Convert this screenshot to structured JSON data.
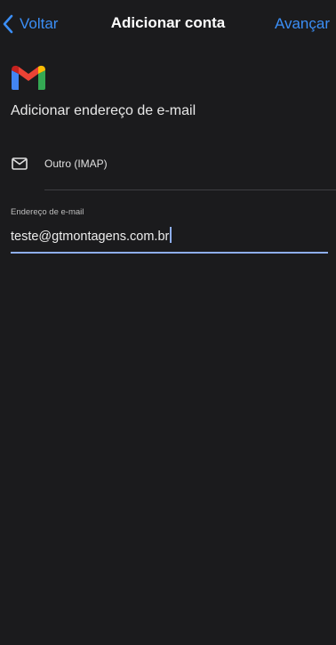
{
  "nav": {
    "back_label": "Voltar",
    "title": "Adicionar conta",
    "next_label": "Avançar",
    "accent_color": "#3b8ef5"
  },
  "logo": {
    "icon": "gmail-logo-icon"
  },
  "heading": "Adicionar endereço de e-mail",
  "account_type": {
    "icon": "mail-icon",
    "label": "Outro (IMAP)"
  },
  "email_field": {
    "label": "Endereço de e-mail",
    "value": "teste@gtmontagens.com.br",
    "underline_color": "#8eaef0"
  },
  "colors": {
    "background": "#1b1b1d",
    "text": "#ffffff"
  }
}
